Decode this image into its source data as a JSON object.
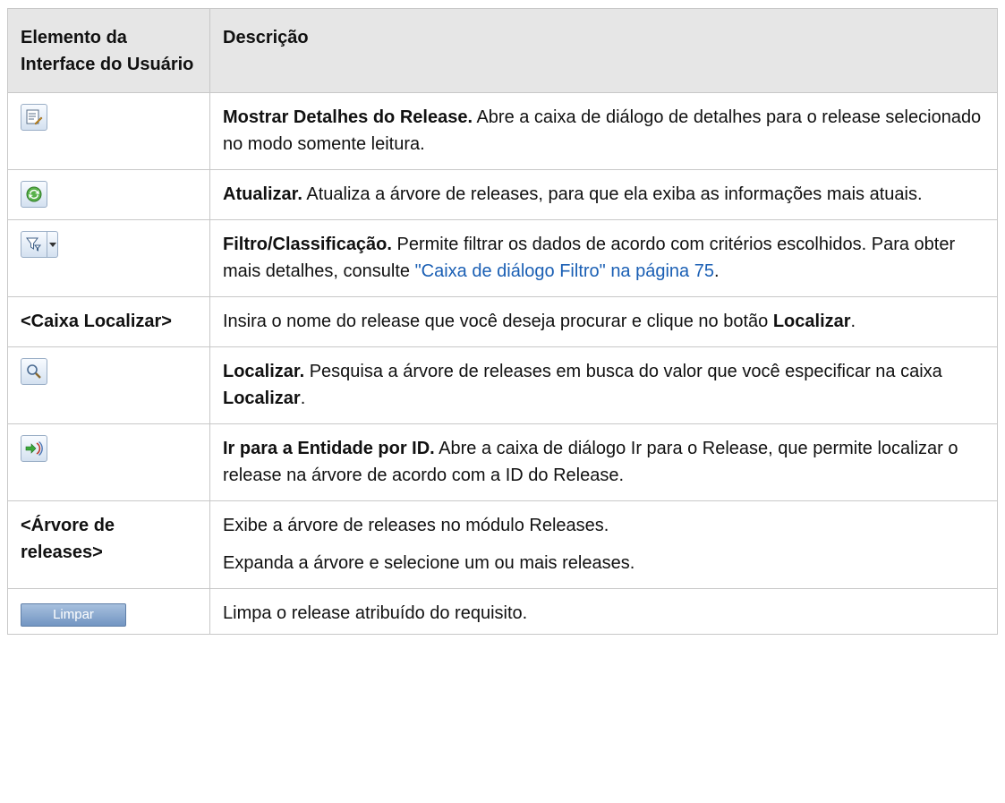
{
  "header": {
    "col1": "Elemento da Interface do Usuário",
    "col2": "Descrição"
  },
  "rows": [
    {
      "icon": "show-details-icon",
      "title": "Mostrar Detalhes do Release.",
      "text": " Abre a caixa de diálogo de detalhes para o release selecionado no modo somente leitura."
    },
    {
      "icon": "refresh-icon",
      "title": "Atualizar.",
      "text": " Atualiza a árvore de releases, para que ela exiba as informações mais atuais."
    },
    {
      "icon": "filter-icon",
      "title": "Filtro/Classificação.",
      "text": " Permite filtrar os dados de acordo com critérios escolhidos. Para obter mais detalhes, consulte ",
      "link": "\"Caixa de diálogo Filtro\" na página 75",
      "after": "."
    },
    {
      "label": "<Caixa Localizar>",
      "text": "Insira o nome do release que você deseja procurar e clique no botão ",
      "bold": "Localizar",
      "after": "."
    },
    {
      "icon": "find-icon",
      "title": "Localizar.",
      "text": " Pesquisa a árvore de releases em busca do valor que você especificar na caixa ",
      "bold": "Localizar",
      "after": "."
    },
    {
      "icon": "go-to-entity-icon",
      "title": "Ir para a Entidade por ID.",
      "text": " Abre a caixa de diálogo Ir para o Release, que permite localizar o release na árvore de acordo com a ID do Release."
    },
    {
      "label": "<Árvore de releases>",
      "text": "Exibe a árvore de releases no módulo Releases.",
      "text2": "Expanda a árvore e selecione um ou mais releases."
    },
    {
      "button": "Limpar",
      "text": "Limpa o release atribuído do requisito."
    }
  ]
}
